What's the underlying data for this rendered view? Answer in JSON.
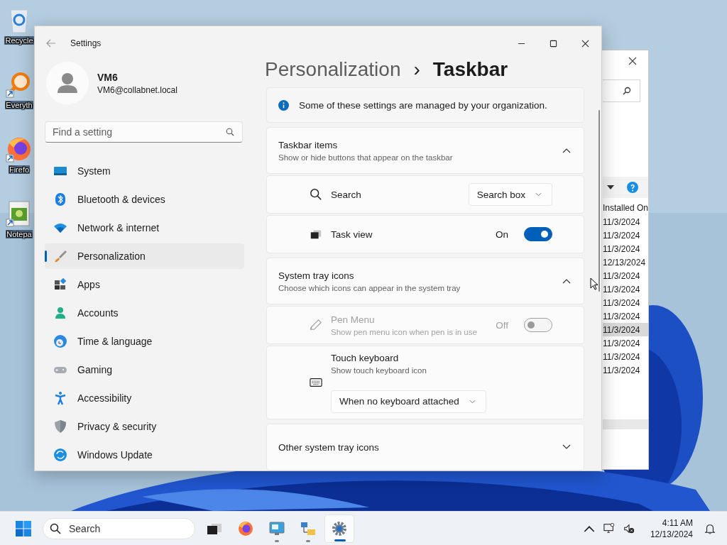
{
  "desktop_icons": [
    {
      "label": "Recycle",
      "shortcut": false
    },
    {
      "label": "Everyth",
      "shortcut": true
    },
    {
      "label": "Firefo",
      "shortcut": true
    },
    {
      "label": "Notepa",
      "shortcut": true
    }
  ],
  "background_window": {
    "column_heading": "Installed On",
    "rows": [
      {
        "installed_on": "11/3/2024",
        "selected": false
      },
      {
        "installed_on": "11/3/2024",
        "selected": false
      },
      {
        "installed_on": "11/3/2024",
        "selected": false
      },
      {
        "installed_on": "12/13/2024",
        "selected": false
      },
      {
        "installed_on": "11/3/2024",
        "selected": false
      },
      {
        "installed_on": "11/3/2024",
        "selected": false
      },
      {
        "installed_on": "11/3/2024",
        "selected": false
      },
      {
        "installed_on": "11/3/2024",
        "selected": false
      },
      {
        "installed_on": "11/3/2024",
        "selected": true
      },
      {
        "installed_on": "11/3/2024",
        "selected": false
      },
      {
        "installed_on": "11/3/2024",
        "selected": false
      },
      {
        "installed_on": "11/3/2024",
        "selected": false
      }
    ]
  },
  "settings": {
    "title": "Settings",
    "user": {
      "name": "VM6",
      "email": "VM6@collabnet.local"
    },
    "search": {
      "placeholder": "Find a setting"
    },
    "nav": [
      {
        "label": "System",
        "selected": false
      },
      {
        "label": "Bluetooth & devices",
        "selected": false
      },
      {
        "label": "Network & internet",
        "selected": false
      },
      {
        "label": "Personalization",
        "selected": true
      },
      {
        "label": "Apps",
        "selected": false
      },
      {
        "label": "Accounts",
        "selected": false
      },
      {
        "label": "Time & language",
        "selected": false
      },
      {
        "label": "Gaming",
        "selected": false
      },
      {
        "label": "Accessibility",
        "selected": false
      },
      {
        "label": "Privacy & security",
        "selected": false
      },
      {
        "label": "Windows Update",
        "selected": false
      }
    ],
    "breadcrumb": {
      "parent": "Personalization",
      "separator": "›",
      "current": "Taskbar"
    },
    "notice": "Some of these settings are managed by your organization.",
    "sections": [
      {
        "title": "Taskbar items",
        "subtitle": "Show or hide buttons that appear on the taskbar",
        "expanded": true,
        "rows": [
          {
            "kind": "dropdown",
            "label": "Search",
            "value": "Search box",
            "disabled": false
          },
          {
            "kind": "toggle",
            "label": "Task view",
            "on": true,
            "state_label": "On",
            "disabled": false
          }
        ]
      },
      {
        "title": "System tray icons",
        "subtitle": "Choose which icons can appear in the system tray",
        "expanded": true,
        "rows": [
          {
            "kind": "toggle",
            "label": "Pen Menu",
            "description": "Show pen menu icon when pen is in use",
            "on": false,
            "state_label": "Off",
            "disabled": true
          },
          {
            "kind": "dropdown_below",
            "label": "Touch keyboard",
            "description": "Show touch keyboard icon",
            "value": "When no keyboard attached",
            "disabled": false
          }
        ]
      },
      {
        "title": "Other system tray icons",
        "expanded": false
      }
    ]
  },
  "taskbar": {
    "search_placeholder": "Search",
    "apps": [
      {
        "running": false,
        "active": false
      },
      {
        "running": false,
        "active": false
      },
      {
        "running": true,
        "active": false
      },
      {
        "running": true,
        "active": false
      },
      {
        "running": true,
        "active": true
      }
    ],
    "time": "4:11 AM",
    "date": "12/13/2024"
  }
}
